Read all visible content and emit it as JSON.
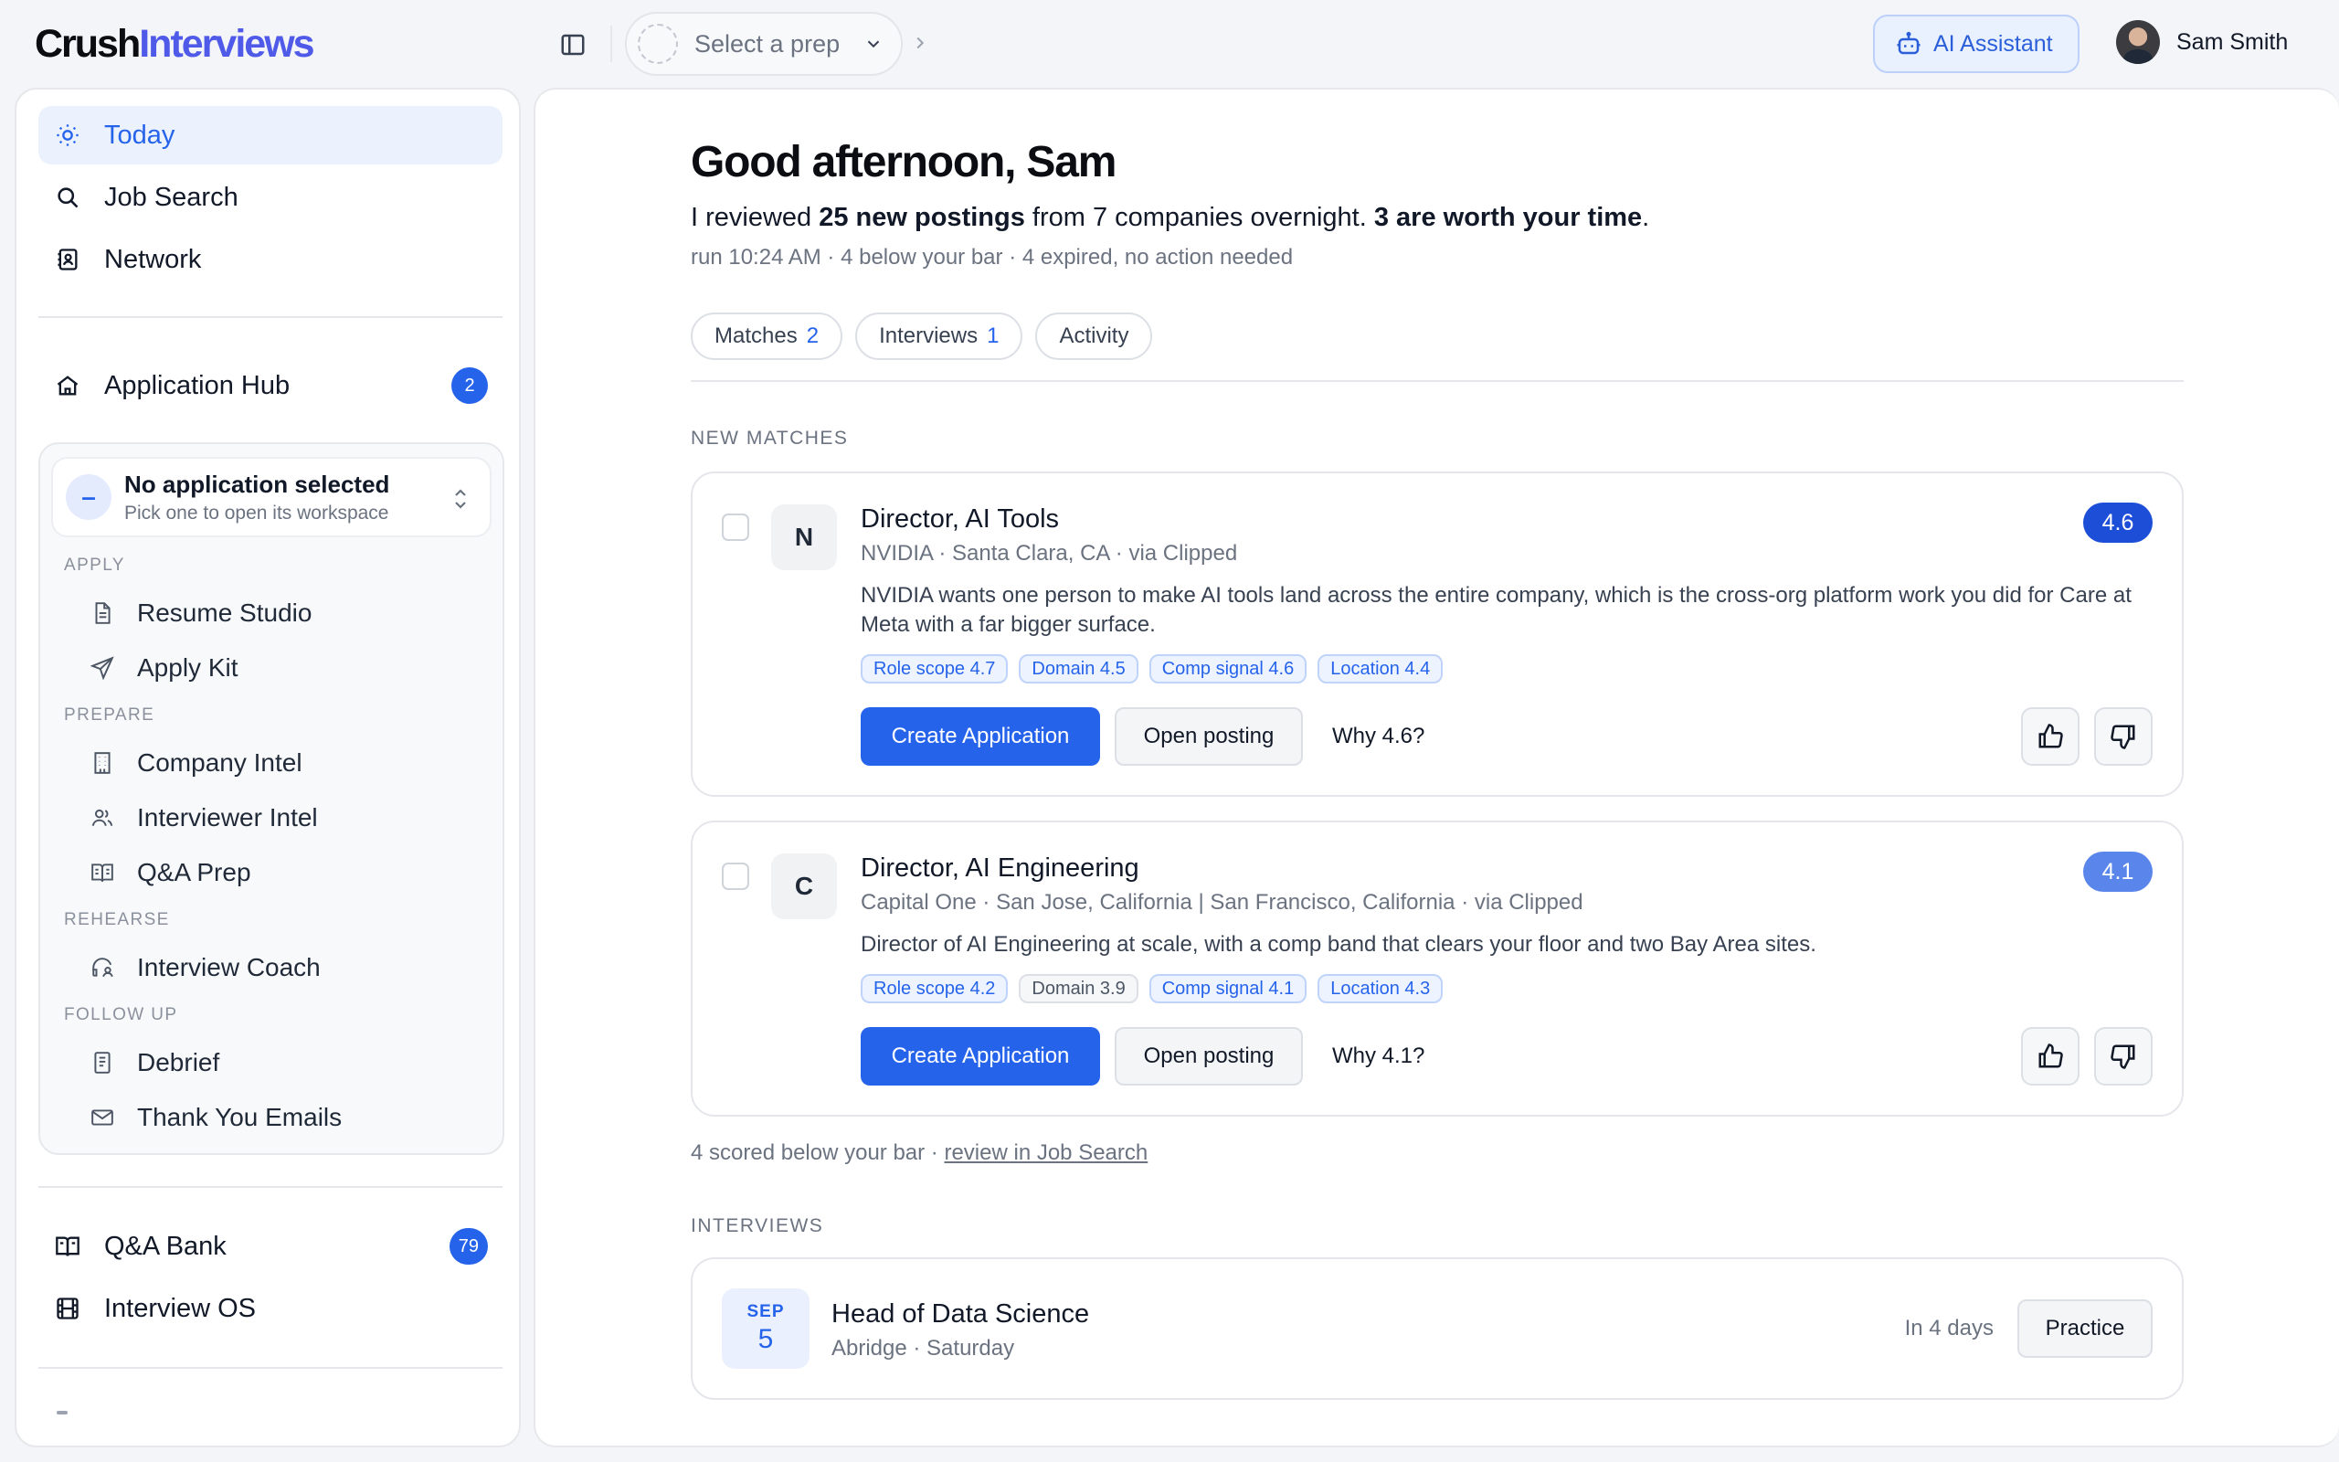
{
  "app": {
    "logo_part1": "Crush",
    "logo_part2": "Interviews"
  },
  "topbar": {
    "prep_placeholder": "Select a prep",
    "ai_assistant_label": "AI Assistant",
    "user_name": "Sam Smith"
  },
  "sidebar": {
    "primary": [
      {
        "label": "Today",
        "icon": "sun-icon",
        "active": true
      },
      {
        "label": "Job Search",
        "icon": "search-icon"
      },
      {
        "label": "Network",
        "icon": "contacts-icon"
      }
    ],
    "hub": {
      "label": "Application Hub",
      "badge": "2"
    },
    "selector": {
      "title": "No application selected",
      "subtitle": "Pick one to open its workspace",
      "icon_text": "–"
    },
    "groups": {
      "apply": "APPLY",
      "prepare": "PREPARE",
      "rehearse": "REHEARSE",
      "follow_up": "FOLLOW UP"
    },
    "items": {
      "resume_studio": "Resume Studio",
      "apply_kit": "Apply Kit",
      "company_intel": "Company Intel",
      "interviewer_intel": "Interviewer Intel",
      "qa_prep": "Q&A Prep",
      "interview_coach": "Interview Coach",
      "debrief": "Debrief",
      "thank_you_emails": "Thank You Emails"
    },
    "bottom": {
      "qa_bank": "Q&A Bank",
      "qa_bank_badge": "79",
      "interview_os": "Interview OS"
    }
  },
  "main": {
    "greeting": "Good afternoon, Sam",
    "summary": {
      "p1": "I reviewed ",
      "b1": "25 new postings",
      "p2": " from 7 companies overnight. ",
      "b2": "3 are worth your time",
      "p3": "."
    },
    "meta": "run 10:24 AM · 4 below your bar · 4 expired, no action needed",
    "tabs": [
      {
        "label": "Matches",
        "count": "2"
      },
      {
        "label": "Interviews",
        "count": "1"
      },
      {
        "label": "Activity",
        "count": ""
      }
    ],
    "new_matches_label": "NEW MATCHES",
    "matches": [
      {
        "logo_letter": "N",
        "title": "Director, AI Tools",
        "subtitle": "NVIDIA · Santa Clara, CA · via Clipped",
        "description": "NVIDIA wants one person to make AI tools land across the entire company, which is the cross-org platform work you did for Care at Meta with a far bigger surface.",
        "score": "4.6",
        "score_color": "#1d4ed8",
        "chips": [
          "Role scope 4.7",
          "Domain 4.5",
          "Comp signal 4.6",
          "Location 4.4"
        ],
        "create_label": "Create Application",
        "open_label": "Open posting",
        "why_label": "Why 4.6?"
      },
      {
        "logo_letter": "C",
        "title": "Director, AI Engineering",
        "subtitle": "Capital One · San Jose, California | San Francisco, California · via Clipped",
        "description": "Director of AI Engineering at scale, with a comp band that clears your floor and two Bay Area sites.",
        "score": "4.1",
        "score_color": "#5a86ec",
        "chips": [
          "Role scope 4.2",
          "Domain 3.9",
          "Comp signal 4.1",
          "Location 4.3"
        ],
        "create_label": "Create Application",
        "open_label": "Open posting",
        "why_label": "Why 4.1?"
      }
    ],
    "below_bar": {
      "text": "4 scored below your bar · ",
      "link": "review in Job Search"
    },
    "interviews_label": "INTERVIEWS",
    "interview": {
      "month": "SEP",
      "day": "5",
      "title": "Head of Data Science",
      "subtitle": "Abridge · Saturday",
      "when": "In 4 days",
      "practice_label": "Practice"
    }
  }
}
